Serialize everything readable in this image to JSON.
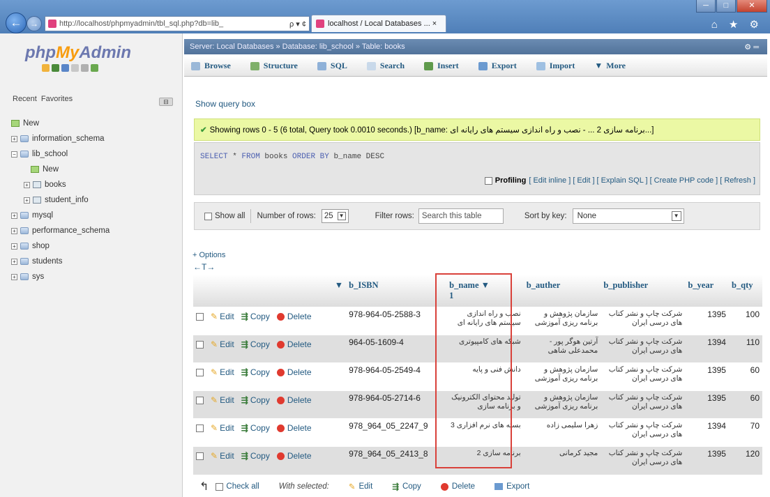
{
  "browser": {
    "address": "http://localhost/phpmyadmin/tbl_sql.php?db=lib_",
    "address_host": "localhost",
    "address_controls": "ρ ▾ ¢",
    "tab_title": "localhost / Local Databases ... ×",
    "window_buttons": [
      "─",
      "□",
      "✕"
    ],
    "right_icons": "⌂ ★ ⚙"
  },
  "sidebar": {
    "logo_php": "php",
    "logo_my": "My",
    "logo_admin": "Admin",
    "recent": "Recent",
    "favorites": "Favorites",
    "tree": [
      {
        "label": "New",
        "level": 0,
        "type": "new"
      },
      {
        "label": "information_schema",
        "level": 0,
        "type": "db"
      },
      {
        "label": "lib_school",
        "level": 0,
        "type": "db"
      },
      {
        "label": "New",
        "level": 1,
        "type": "new"
      },
      {
        "label": "books",
        "level": 1,
        "type": "table"
      },
      {
        "label": "student_info",
        "level": 1,
        "type": "table"
      },
      {
        "label": "mysql",
        "level": 0,
        "type": "db"
      },
      {
        "label": "performance_schema",
        "level": 0,
        "type": "db"
      },
      {
        "label": "shop",
        "level": 0,
        "type": "db"
      },
      {
        "label": "students",
        "level": 0,
        "type": "db"
      },
      {
        "label": "sys",
        "level": 0,
        "type": "db"
      }
    ]
  },
  "breadcrumb": "Server: Local Databases » Database: lib_school » Table: books",
  "menu": [
    "Browse",
    "Structure",
    "SQL",
    "Search",
    "Insert",
    "Export",
    "Import",
    "More"
  ],
  "query_box_link": "Show query box",
  "success_message": "Showing rows 0 - 5 (6 total, Query took 0.0010 seconds.) [b_name: برنامه سازی 2 ... - نصب و راه اندازی سیستم های رایانه ای...]",
  "sql": {
    "select": "SELECT",
    "star": " * ",
    "from": "FROM",
    "table": " books ",
    "order": "ORDER BY",
    "rest": " b_name DESC"
  },
  "sql_options": {
    "profiling": "Profiling",
    "links": "[ Edit inline ] [ Edit ] [ Explain SQL ] [ Create PHP code ] [ Refresh ]"
  },
  "nav": {
    "show_all": "Show all",
    "number_of_rows_label": "Number of rows:",
    "number_of_rows": "25",
    "filter_label": "Filter rows:",
    "filter_placeholder": "Search this table",
    "sort_label": "Sort by key:",
    "sort_value": "None"
  },
  "options_link": "+ Options",
  "arrows": "←T→",
  "columns": [
    "b_ISBN",
    "b_name",
    "b_auther",
    "b_publisher",
    "b_year",
    "b_qty"
  ],
  "sort_indicator": "▼",
  "sort_number": "1",
  "row_actions": {
    "edit": "Edit",
    "copy": "Copy",
    "delete": "Delete"
  },
  "rows": [
    {
      "isbn": "978-964-05-2588-3",
      "name": "نصب و راه اندازی سیستم های رایانه ای",
      "auther": "سازمان پژوهش و برنامه ریزی آموزشی",
      "publisher": "شرکت چاپ و نشر کتاب های درسی ایران",
      "year": "1395",
      "qty": "100"
    },
    {
      "isbn": "964-05-1609-4",
      "name": "شبکه های کامپیوتری",
      "auther": "آرتین هوگر پور - محمدعلی شاهی",
      "publisher": "شرکت چاپ و نشر کتاب های درسی ایران",
      "year": "1394",
      "qty": "110"
    },
    {
      "isbn": "978-964-05-2549-4",
      "name": "دانش فنی و پایه",
      "auther": "سازمان پژوهش و برنامه ریزی آموزشی",
      "publisher": "شرکت چاپ و نشر کتاب های درسی ایران",
      "year": "1395",
      "qty": "60"
    },
    {
      "isbn": "978-964-05-2714-6",
      "name": "تولید محتوای الکترونیک و برنامه سازی",
      "auther": "سازمان پژوهش و برنامه ریزی آموزشی",
      "publisher": "شرکت چاپ و نشر کتاب های درسی ایران",
      "year": "1395",
      "qty": "60"
    },
    {
      "isbn": "978_964_05_2247_9",
      "name": "بسته های نرم افزاری 3",
      "auther": "زهرا سلیمی زاده",
      "publisher": "شرکت چاپ و نشر کتاب های درسی ایران",
      "year": "1394",
      "qty": "70"
    },
    {
      "isbn": "978_964_05_2413_8",
      "name": "برنامه سازی 2",
      "auther": "مجید کرمانی",
      "publisher": "شرکت چاپ و نشر کتاب های درسی ایران",
      "year": "1395",
      "qty": "120"
    }
  ],
  "bottom": {
    "check_all": "Check all",
    "with_selected": "With selected:",
    "edit": "Edit",
    "copy": "Copy",
    "delete": "Delete",
    "export": "Export"
  },
  "colors": {
    "accent": "#235a81",
    "success_bg": "#ebf8a4",
    "highlight": "#d9413a"
  }
}
